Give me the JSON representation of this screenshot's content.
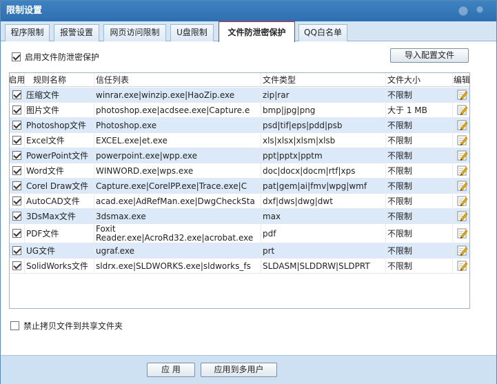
{
  "window": {
    "title": "限制设置"
  },
  "tabs": [
    {
      "label": "程序限制",
      "active": false
    },
    {
      "label": "报警设置",
      "active": false
    },
    {
      "label": "网页访问限制",
      "active": false
    },
    {
      "label": "U盘限制",
      "active": false
    },
    {
      "label": "文件防泄密保护",
      "active": true
    },
    {
      "label": "QQ白名单",
      "active": false
    }
  ],
  "enable_protection": {
    "label": "启用文件防泄密保护",
    "checked": true
  },
  "import_button": "导入配置文件",
  "table": {
    "headers": [
      "启用",
      "规则名称",
      "信任列表",
      "文件类型",
      "文件大小",
      "编辑"
    ],
    "rows": [
      {
        "enabled": true,
        "name": "压缩文件",
        "trust": "winrar.exe|winzip.exe|HaoZip.exe",
        "types": "zip|rar",
        "size": "不限制"
      },
      {
        "enabled": true,
        "name": "图片文件",
        "trust": "photoshop.exe|acdsee.exe|Capture.e",
        "types": "bmp|jpg|png",
        "size": "大于 1 MB"
      },
      {
        "enabled": true,
        "name": "Photoshop文件",
        "trust": "Photoshop.exe",
        "types": "psd|tif|eps|pdd|psb",
        "size": "不限制"
      },
      {
        "enabled": true,
        "name": "Excel文件",
        "trust": "EXCEL.exe|et.exe",
        "types": "xls|xlsx|xlsm|xlsb",
        "size": "不限制"
      },
      {
        "enabled": true,
        "name": "PowerPoint文件",
        "trust": "powerpoint.exe|wpp.exe",
        "types": "ppt|pptx|pptm",
        "size": "不限制"
      },
      {
        "enabled": true,
        "name": "Word文件",
        "trust": "WINWORD.exe|wps.exe",
        "types": "doc|docx|docm|rtf|xps",
        "size": "不限制"
      },
      {
        "enabled": true,
        "name": "Corel Draw文件",
        "trust": "Capture.exe|CorelPP.exe|Trace.exe|C",
        "types": "pat|gem|ai|fmv|wpg|wmf",
        "size": "不限制"
      },
      {
        "enabled": true,
        "name": "AutoCAD文件",
        "trust": "acad.exe|AdRefMan.exe|DwgCheckSta",
        "types": "dxf|dws|dwg|dwt",
        "size": "不限制"
      },
      {
        "enabled": true,
        "name": "3DsMax文件",
        "trust": "3dsmax.exe",
        "types": "max",
        "size": "不限制"
      },
      {
        "enabled": true,
        "name": "PDF文件",
        "trust_lines": [
          "Foxit",
          "Reader.exe|AcroRd32.exe|acrobat.exe"
        ],
        "types": "pdf",
        "size": "不限制"
      },
      {
        "enabled": true,
        "name": "UG文件",
        "trust": "ugraf.exe",
        "types": "prt",
        "size": "不限制"
      },
      {
        "enabled": true,
        "name": "SolidWorks文件",
        "trust": "sldrx.exe|SLDWORKS.exe|sldworks_fs",
        "types": "SLDASM|SLDDRW|SLDPRT",
        "size": "不限制"
      }
    ]
  },
  "share_copy": {
    "label": "禁止拷贝文件到共享文件夹",
    "checked": false
  },
  "footer": {
    "apply": "应 用",
    "apply_multi": "应用到多用户"
  },
  "colors": {
    "title_bar": "#3a7cbd",
    "tab_bar": "#d5e5f4",
    "row_alt": "#dbe9f8",
    "active_tab_border": "#d02828",
    "footer": "#cde1f3"
  }
}
